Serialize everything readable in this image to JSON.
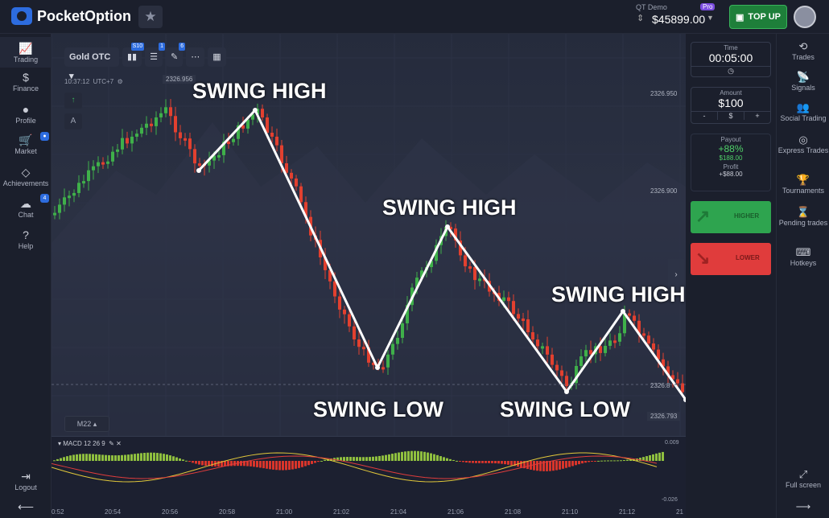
{
  "app": {
    "brand": "PocketOption"
  },
  "account": {
    "label": "QT Demo",
    "tier": "Pro",
    "balance": "$45899.00",
    "topup_label": "TOP UP"
  },
  "left_nav": [
    {
      "label": "Trading",
      "icon": "chart-line-icon"
    },
    {
      "label": "Finance",
      "icon": "dollar-icon"
    },
    {
      "label": "Profile",
      "icon": "user-icon"
    },
    {
      "label": "Market",
      "icon": "cart-icon"
    },
    {
      "label": "Achievements",
      "icon": "diamond-icon"
    },
    {
      "label": "Chat",
      "icon": "chat-icon"
    },
    {
      "label": "Help",
      "icon": "help-icon"
    }
  ],
  "left_nav_bottom": {
    "logout": "Logout"
  },
  "toolbar": {
    "asset": "Gold OTC",
    "badge_indicators": "S10",
    "badge_settings": "1",
    "badge_drawings": "6"
  },
  "chart": {
    "time": "10:37:12",
    "timezone": "UTC+7",
    "price_top": "2326.956",
    "price_1": "2326.950",
    "price_2": "2326.900",
    "price_3": "2326.8",
    "price_current": "2326.793",
    "timeframe": "M22",
    "annotations": [
      "SWING HIGH",
      "SWING HIGH",
      "SWING HIGH",
      "SWING LOW",
      "SWING LOW"
    ],
    "x_ticks": [
      "0:52",
      "20:54",
      "20:56",
      "20:58",
      "21:00",
      "21:02",
      "21:04",
      "21:06",
      "21:08",
      "21:10",
      "21:12",
      "21"
    ]
  },
  "macd": {
    "label": "MACD  12 26 9",
    "top_value": "0.009",
    "bottom_value": "-0.026"
  },
  "trade_panel": {
    "time_label": "Time",
    "time_value": "00:05:00",
    "amount_label": "Amount",
    "amount_value": "$100",
    "payout_label": "Payout",
    "payout_percent": "+88%",
    "payout_amount": "$188.00",
    "profit_label": "Profit",
    "profit_amount": "+$88.00",
    "higher_label": "HIGHER",
    "lower_label": "LOWER"
  },
  "right_nav": [
    {
      "label": "Trades"
    },
    {
      "label": "Signals"
    },
    {
      "label": "Social Trading"
    },
    {
      "label": "Express Trades"
    },
    {
      "label": "Tournaments"
    },
    {
      "label": "Pending trades"
    },
    {
      "label": "Hotkeys"
    }
  ],
  "right_nav_bottom": {
    "fullscreen": "Full screen"
  },
  "colors": {
    "bull": "#3fb04a",
    "bear": "#e2402f",
    "accent": "#2d6cdf"
  }
}
